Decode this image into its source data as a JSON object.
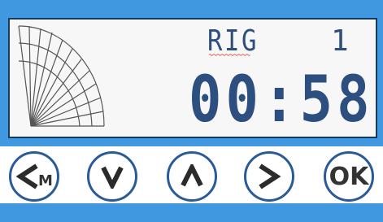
{
  "display": {
    "program_label": "RIG",
    "program_number": "1",
    "time": "00:58"
  },
  "buttons": {
    "menu_back_label": "M",
    "ok_label": "OK"
  },
  "colors": {
    "frame": "#3f98e0",
    "lcd_text": "#2c4f80",
    "button_border": "#2a5b98"
  }
}
